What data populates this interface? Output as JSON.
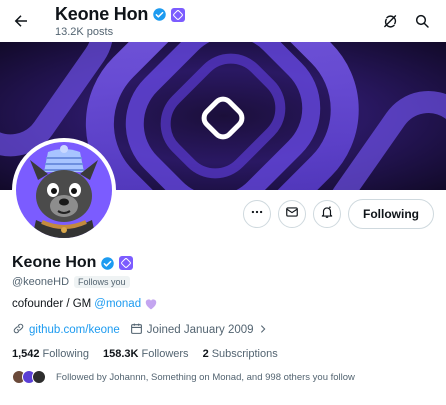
{
  "header": {
    "title": "Keone Hon",
    "posts": "13.2K posts",
    "icons": [
      "back-arrow-icon",
      "verified-badge-icon",
      "affiliate-badge-icon",
      "grok-icon",
      "search-icon"
    ]
  },
  "profile": {
    "name": "Keone Hon",
    "handle": "@keoneHD",
    "follows_you": "Follows you",
    "bio_text": "cofounder / GM",
    "bio_mention": "@monad",
    "website": "github.com/keone",
    "joined": "Joined January 2009",
    "stats": {
      "following_count": "1,542",
      "following_label": "Following",
      "followers_count": "158.3K",
      "followers_label": "Followers",
      "subs_count": "2",
      "subs_label": "Subscriptions"
    },
    "followed_by": "Followed by Johannn, Something on Monad, and 998 others you follow"
  },
  "actions": {
    "following_label": "Following",
    "icons": [
      "more-icon",
      "message-icon",
      "notification-bell-icon"
    ]
  },
  "colors": {
    "accent": "#1d9bf0",
    "banner": "#5b3fd6",
    "monad_purple": "#7c5cff",
    "heart": "#c4a5f0"
  }
}
